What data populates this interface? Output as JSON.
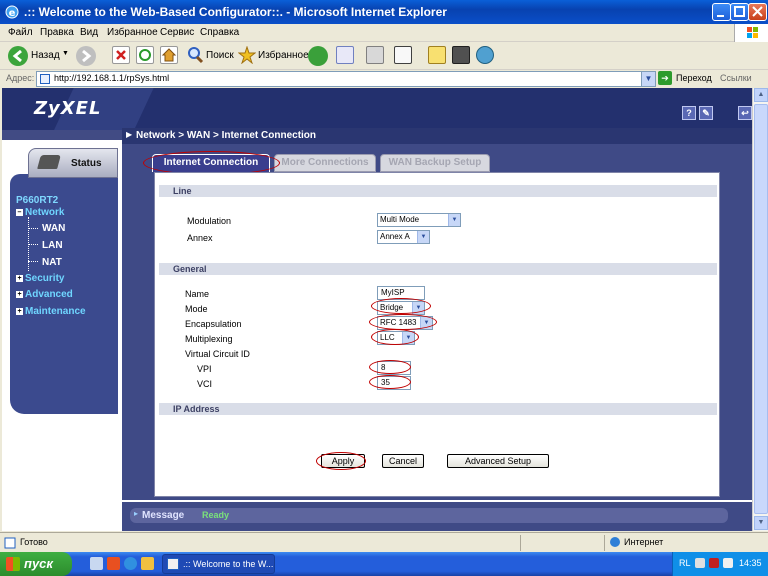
{
  "window": {
    "title": ".:: Welcome to the Web-Based Configurator::. - Microsoft Internet Explorer"
  },
  "menu": [
    "Файл",
    "Правка",
    "Вид",
    "Избранное",
    "Сервис",
    "Справка"
  ],
  "toolbar": {
    "back_label": "Назад",
    "search_label": "Поиск",
    "favorites_label": "Избранное"
  },
  "address": {
    "label": "Адрес:",
    "url": "http://192.168.1.1/rpSys.html",
    "go_label": "Переход",
    "links_label": "Ссылки"
  },
  "brand": {
    "logo": "ZyXEL"
  },
  "sidebar": {
    "status_label": "Status",
    "model": "P660RT2",
    "network_label": "Network",
    "network_items": [
      "WAN",
      "LAN",
      "NAT"
    ],
    "security_label": "Security",
    "advanced_label": "Advanced",
    "maintenance_label": "Maintenance"
  },
  "breadcrumb": "Network > WAN > Internet Connection",
  "tabs": [
    "Internet Connection",
    "More Connections",
    "WAN Backup Setup"
  ],
  "sections": {
    "line": "Line",
    "general": "General",
    "ip": "IP Address"
  },
  "fields": {
    "modulation_label": "Modulation",
    "modulation_value": "Multi Mode",
    "annex_label": "Annex",
    "annex_value": "Annex A",
    "name_label": "Name",
    "name_value": "MyISP",
    "mode_label": "Mode",
    "mode_value": "Bridge",
    "encap_label": "Encapsulation",
    "encap_value": "RFC 1483",
    "mux_label": "Multiplexing",
    "mux_value": "LLC",
    "vc_label": "Virtual Circuit ID",
    "vpi_label": "VPI",
    "vpi_value": "8",
    "vci_label": "VCI",
    "vci_value": "35"
  },
  "buttons": {
    "apply": "Apply",
    "cancel": "Cancel",
    "advanced": "Advanced Setup"
  },
  "message": {
    "label": "Message",
    "value": "Ready"
  },
  "statusbar": {
    "status": "Готово",
    "zone": "Интернет"
  },
  "taskbar": {
    "start_label": "пуск",
    "task_label": ".:: Welcome to the W...",
    "lang": "RL",
    "clock": "14:35"
  }
}
